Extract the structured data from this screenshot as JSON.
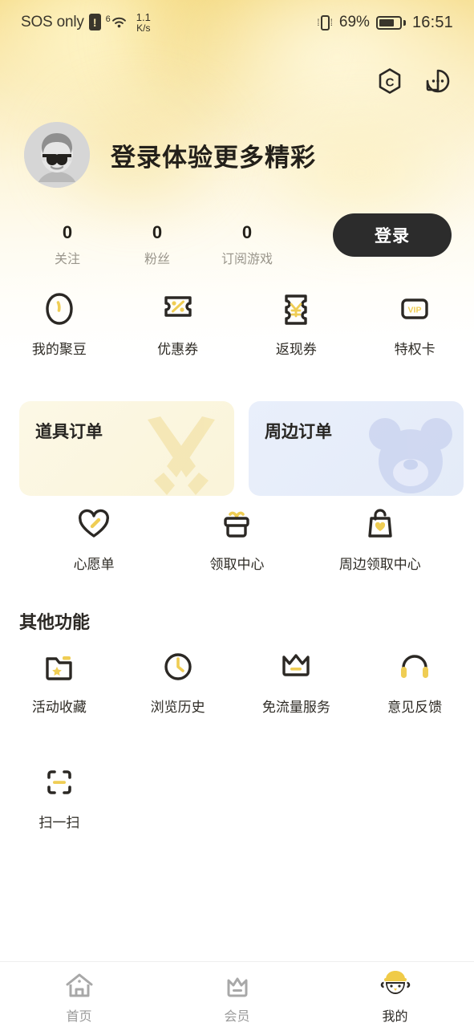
{
  "status_bar": {
    "carrier": "SOS only",
    "alert_badge": "!",
    "wifi_gen": "6",
    "speed_value": "1.1",
    "speed_unit": "K/s",
    "battery_percent": "69%",
    "clock": "16:51"
  },
  "header": {
    "icons": [
      {
        "name": "community-hexagon-icon",
        "label": "C"
      },
      {
        "name": "message-bubble-icon",
        "label": ""
      }
    ]
  },
  "profile": {
    "avatar_name": "default-avatar-sunglasses",
    "title": "登录体验更多精彩",
    "login_button": "登录",
    "stats": [
      {
        "value": "0",
        "label": "关注"
      },
      {
        "value": "0",
        "label": "粉丝"
      },
      {
        "value": "0",
        "label": "订阅游戏"
      }
    ]
  },
  "quick_actions": [
    {
      "icon": "bean-icon",
      "label": "我的聚豆"
    },
    {
      "icon": "coupon-percent-icon",
      "label": "优惠券"
    },
    {
      "icon": "coupon-yuan-icon",
      "label": "返现券"
    },
    {
      "icon": "vip-card-icon",
      "label": "特权卡"
    }
  ],
  "order_cards": [
    {
      "title": "道具订单",
      "art": "crossed-swords-art",
      "theme": "#faf4d9"
    },
    {
      "title": "周边订单",
      "art": "bear-art",
      "theme": "#e4ebf8"
    }
  ],
  "service_actions": [
    {
      "icon": "heart-wishlist-icon",
      "label": "心愿单"
    },
    {
      "icon": "gift-box-icon",
      "label": "领取中心"
    },
    {
      "icon": "shopping-bag-heart-icon",
      "label": "周边领取中心"
    }
  ],
  "other_section": {
    "title": "其他功能",
    "items": [
      {
        "icon": "folder-star-icon",
        "label": "活动收藏"
      },
      {
        "icon": "clock-history-icon",
        "label": "浏览历史"
      },
      {
        "icon": "crown-icon",
        "label": "免流量服务"
      },
      {
        "icon": "headset-icon",
        "label": "意见反馈"
      },
      {
        "icon": "scan-frame-icon",
        "label": "扫一扫"
      }
    ]
  },
  "bottom_nav": [
    {
      "icon": "home-icon",
      "label": "首页",
      "active": false
    },
    {
      "icon": "member-crown-icon",
      "label": "会员",
      "active": false
    },
    {
      "icon": "profile-face-icon",
      "label": "我的",
      "active": true
    }
  ],
  "colors": {
    "accent_yellow": "#f3cf52",
    "dark": "#2c2c2c",
    "muted": "#9a968c"
  }
}
